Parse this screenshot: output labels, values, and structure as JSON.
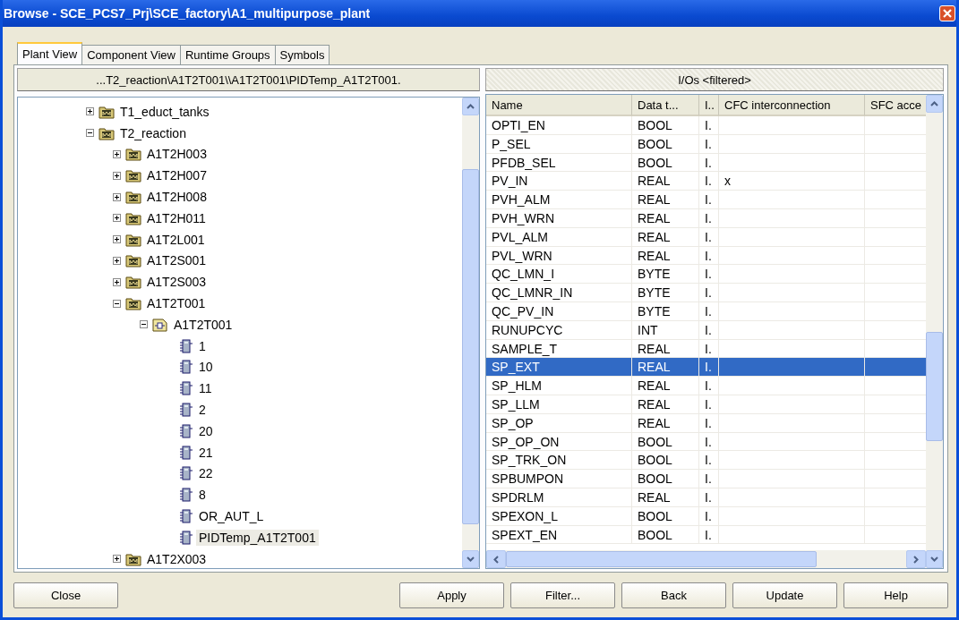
{
  "window": {
    "title": "Browse - SCE_PCS7_Prj\\SCE_factory\\A1_multipurpose_plant"
  },
  "tabs": [
    {
      "label": "Plant View",
      "selected": true
    },
    {
      "label": "Component View",
      "selected": false
    },
    {
      "label": "Runtime Groups",
      "selected": false
    },
    {
      "label": "Symbols",
      "selected": false
    }
  ],
  "path_header": "...T2_reaction\\A1T2T001\\\\A1T2T001\\PIDTemp_A1T2T001.",
  "tree": [
    {
      "label": "T1_educt_tanks",
      "kind": "folder",
      "expanded": false,
      "selected": false
    },
    {
      "label": "T2_reaction",
      "kind": "folder",
      "expanded": true,
      "selected": false,
      "children": [
        {
          "label": "A1T2H003",
          "kind": "folder",
          "expanded": false,
          "selected": false
        },
        {
          "label": "A1T2H007",
          "kind": "folder",
          "expanded": false,
          "selected": false
        },
        {
          "label": "A1T2H008",
          "kind": "folder",
          "expanded": false,
          "selected": false
        },
        {
          "label": "A1T2H011",
          "kind": "folder",
          "expanded": false,
          "selected": false
        },
        {
          "label": "A1T2L001",
          "kind": "folder",
          "expanded": false,
          "selected": false
        },
        {
          "label": "A1T2S001",
          "kind": "folder",
          "expanded": false,
          "selected": false
        },
        {
          "label": "A1T2S003",
          "kind": "folder",
          "expanded": false,
          "selected": false
        },
        {
          "label": "A1T2T001",
          "kind": "folder",
          "expanded": true,
          "selected": false,
          "children": [
            {
              "label": "A1T2T001",
              "kind": "chart",
              "expanded": true,
              "selected": false,
              "children": [
                {
                  "label": "1",
                  "kind": "block",
                  "selected": false
                },
                {
                  "label": "10",
                  "kind": "block",
                  "selected": false
                },
                {
                  "label": "11",
                  "kind": "block",
                  "selected": false
                },
                {
                  "label": "2",
                  "kind": "block",
                  "selected": false
                },
                {
                  "label": "20",
                  "kind": "block",
                  "selected": false
                },
                {
                  "label": "21",
                  "kind": "block",
                  "selected": false
                },
                {
                  "label": "22",
                  "kind": "block",
                  "selected": false
                },
                {
                  "label": "8",
                  "kind": "block",
                  "selected": false
                },
                {
                  "label": "OR_AUT_L",
                  "kind": "block",
                  "selected": false
                },
                {
                  "label": "PIDTemp_A1T2T001",
                  "kind": "block",
                  "selected": true
                }
              ]
            }
          ]
        },
        {
          "label": "A1T2X003",
          "kind": "folder",
          "expanded": false,
          "selected": false
        }
      ]
    }
  ],
  "table": {
    "title": "I/Os <filtered>",
    "columns": [
      "Name",
      "Data t...",
      "I..",
      "CFC interconnection",
      "SFC acce"
    ],
    "rows": [
      {
        "cells": [
          "OPTI_EN",
          "BOOL",
          "I.",
          "",
          ""
        ],
        "selected": false
      },
      {
        "cells": [
          "P_SEL",
          "BOOL",
          "I.",
          "",
          ""
        ],
        "selected": false
      },
      {
        "cells": [
          "PFDB_SEL",
          "BOOL",
          "I.",
          "",
          ""
        ],
        "selected": false
      },
      {
        "cells": [
          "PV_IN",
          "REAL",
          "I.",
          "x",
          ""
        ],
        "selected": false
      },
      {
        "cells": [
          "PVH_ALM",
          "REAL",
          "I.",
          "",
          ""
        ],
        "selected": false
      },
      {
        "cells": [
          "PVH_WRN",
          "REAL",
          "I.",
          "",
          ""
        ],
        "selected": false
      },
      {
        "cells": [
          "PVL_ALM",
          "REAL",
          "I.",
          "",
          ""
        ],
        "selected": false
      },
      {
        "cells": [
          "PVL_WRN",
          "REAL",
          "I.",
          "",
          ""
        ],
        "selected": false
      },
      {
        "cells": [
          "QC_LMN_I",
          "BYTE",
          "I.",
          "",
          ""
        ],
        "selected": false
      },
      {
        "cells": [
          "QC_LMNR_IN",
          "BYTE",
          "I.",
          "",
          ""
        ],
        "selected": false
      },
      {
        "cells": [
          "QC_PV_IN",
          "BYTE",
          "I.",
          "",
          ""
        ],
        "selected": false
      },
      {
        "cells": [
          "RUNUPCYC",
          "INT",
          "I.",
          "",
          ""
        ],
        "selected": false
      },
      {
        "cells": [
          "SAMPLE_T",
          "REAL",
          "I.",
          "",
          ""
        ],
        "selected": false
      },
      {
        "cells": [
          "SP_EXT",
          "REAL",
          "I.",
          "",
          ""
        ],
        "selected": true
      },
      {
        "cells": [
          "SP_HLM",
          "REAL",
          "I.",
          "",
          ""
        ],
        "selected": false
      },
      {
        "cells": [
          "SP_LLM",
          "REAL",
          "I.",
          "",
          ""
        ],
        "selected": false
      },
      {
        "cells": [
          "SP_OP",
          "REAL",
          "I.",
          "",
          ""
        ],
        "selected": false
      },
      {
        "cells": [
          "SP_OP_ON",
          "BOOL",
          "I.",
          "",
          ""
        ],
        "selected": false
      },
      {
        "cells": [
          "SP_TRK_ON",
          "BOOL",
          "I.",
          "",
          ""
        ],
        "selected": false
      },
      {
        "cells": [
          "SPBUMPON",
          "BOOL",
          "I.",
          "",
          ""
        ],
        "selected": false
      },
      {
        "cells": [
          "SPDRLM",
          "REAL",
          "I.",
          "",
          ""
        ],
        "selected": false
      },
      {
        "cells": [
          "SPEXON_L",
          "BOOL",
          "I.",
          "",
          ""
        ],
        "selected": false
      },
      {
        "cells": [
          "SPEXT_EN",
          "BOOL",
          "I.",
          "",
          ""
        ],
        "selected": false
      }
    ]
  },
  "buttons": [
    "Close",
    "Apply",
    "Filter...",
    "Back",
    "Update",
    "Help"
  ]
}
